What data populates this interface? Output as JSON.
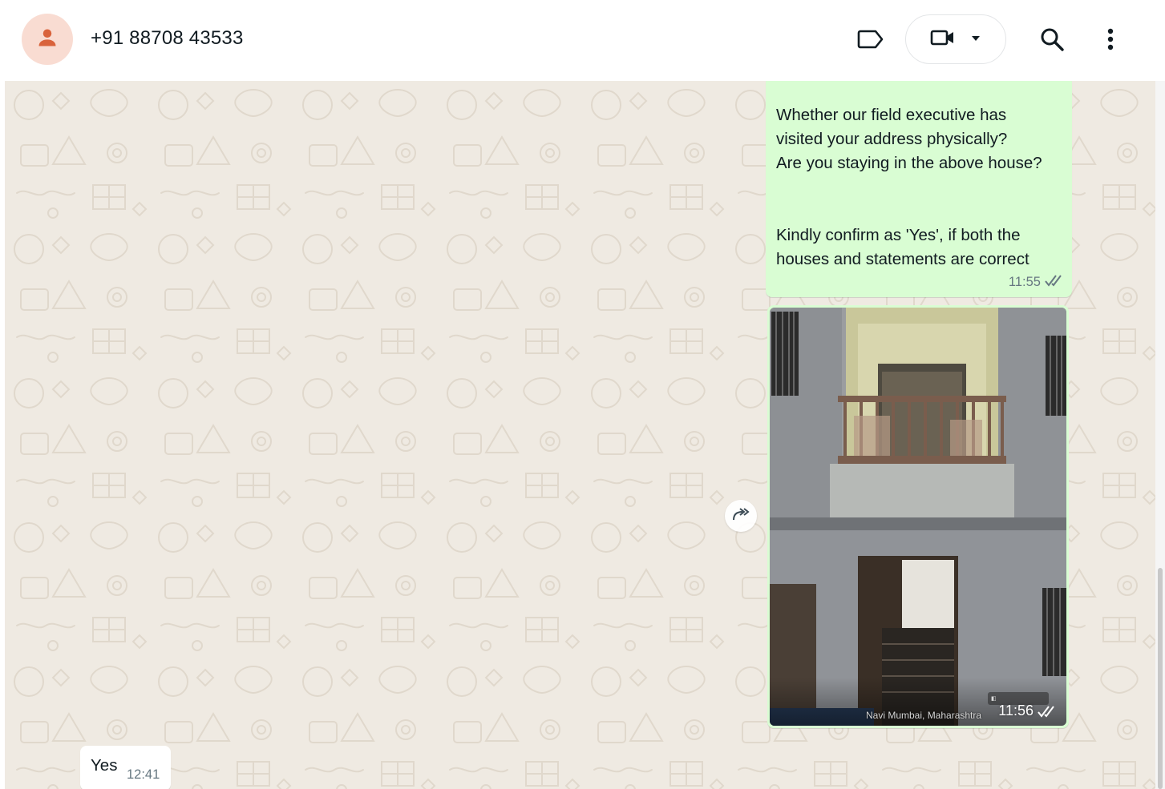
{
  "header": {
    "contact_name": "+91 88708 43533",
    "avatar_icon": "person-icon",
    "label_icon": "label-icon",
    "video_icon": "video-camera-icon",
    "dropdown_icon": "chevron-down-icon",
    "search_icon": "search-icon",
    "menu_icon": "more-vertical-icon"
  },
  "messages": [
    {
      "direction": "outgoing",
      "type": "text",
      "text": "Whether our field executive has\nvisited your address physically?\nAre you staying in the above house?\n\n\nKindly confirm as 'Yes', if both the\nhouses and statements are correct",
      "time": "11:55",
      "status": "read"
    },
    {
      "direction": "outgoing",
      "type": "image",
      "location_caption": "Navi Mumbai, Maharashtra",
      "time": "11:56",
      "status": "read"
    },
    {
      "direction": "incoming",
      "type": "text",
      "text": "Yes",
      "time": "12:41"
    }
  ],
  "forward_icon": "forward-icon",
  "colors": {
    "header_bg": "#ffffff",
    "chat_bg": "#efeae2",
    "outgoing_bubble": "#d9fdd3",
    "incoming_bubble": "#ffffff",
    "avatar_bg": "#f9dcd2",
    "avatar_fg": "#d9633c",
    "meta_text": "#667781"
  }
}
